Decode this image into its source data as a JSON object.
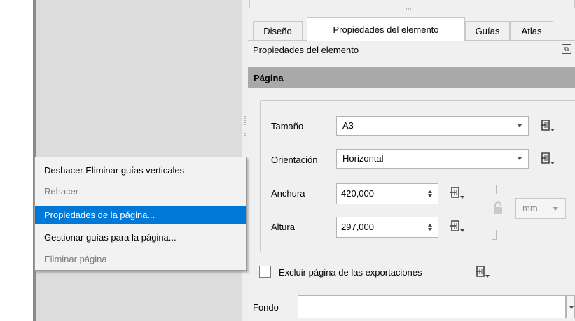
{
  "tabs": [
    "Diseño",
    "Propiedades del elemento",
    "Guías",
    "Atlas"
  ],
  "active_tab": "Propiedades del elemento",
  "panel_title": "Propiedades del elemento",
  "section_header": "Página",
  "page_properties": {
    "size_label": "Tamaño",
    "size_value": "A3",
    "orientation_label": "Orientación",
    "orientation_value": "Horizontal",
    "width_label": "Anchura",
    "width_value": "420,000",
    "height_label": "Altura",
    "height_value": "297,000",
    "unit_value": "mm",
    "exclude_label": "Excluir página de las exportaciones",
    "exclude_checked": false,
    "background_label": "Fondo"
  },
  "context_menu": {
    "items": [
      {
        "label": "Deshacer Eliminar guías verticales",
        "enabled": true,
        "selected": false
      },
      {
        "label": "Rehacer",
        "enabled": false,
        "selected": false
      },
      {
        "label": "Propiedades de la página...",
        "enabled": true,
        "selected": true
      },
      {
        "label": "Gestionar guías para la página...",
        "enabled": true,
        "selected": false
      },
      {
        "label": "Eliminar página",
        "enabled": false,
        "selected": false
      }
    ]
  },
  "icons": {
    "data_defined": "data-defined-override-icon",
    "lock": "lock-icon",
    "float": "float-panel-icon"
  },
  "colors": {
    "selection": "#0078d7",
    "section_header": "#a9a9a9",
    "canvas": "#dcdcdc"
  }
}
